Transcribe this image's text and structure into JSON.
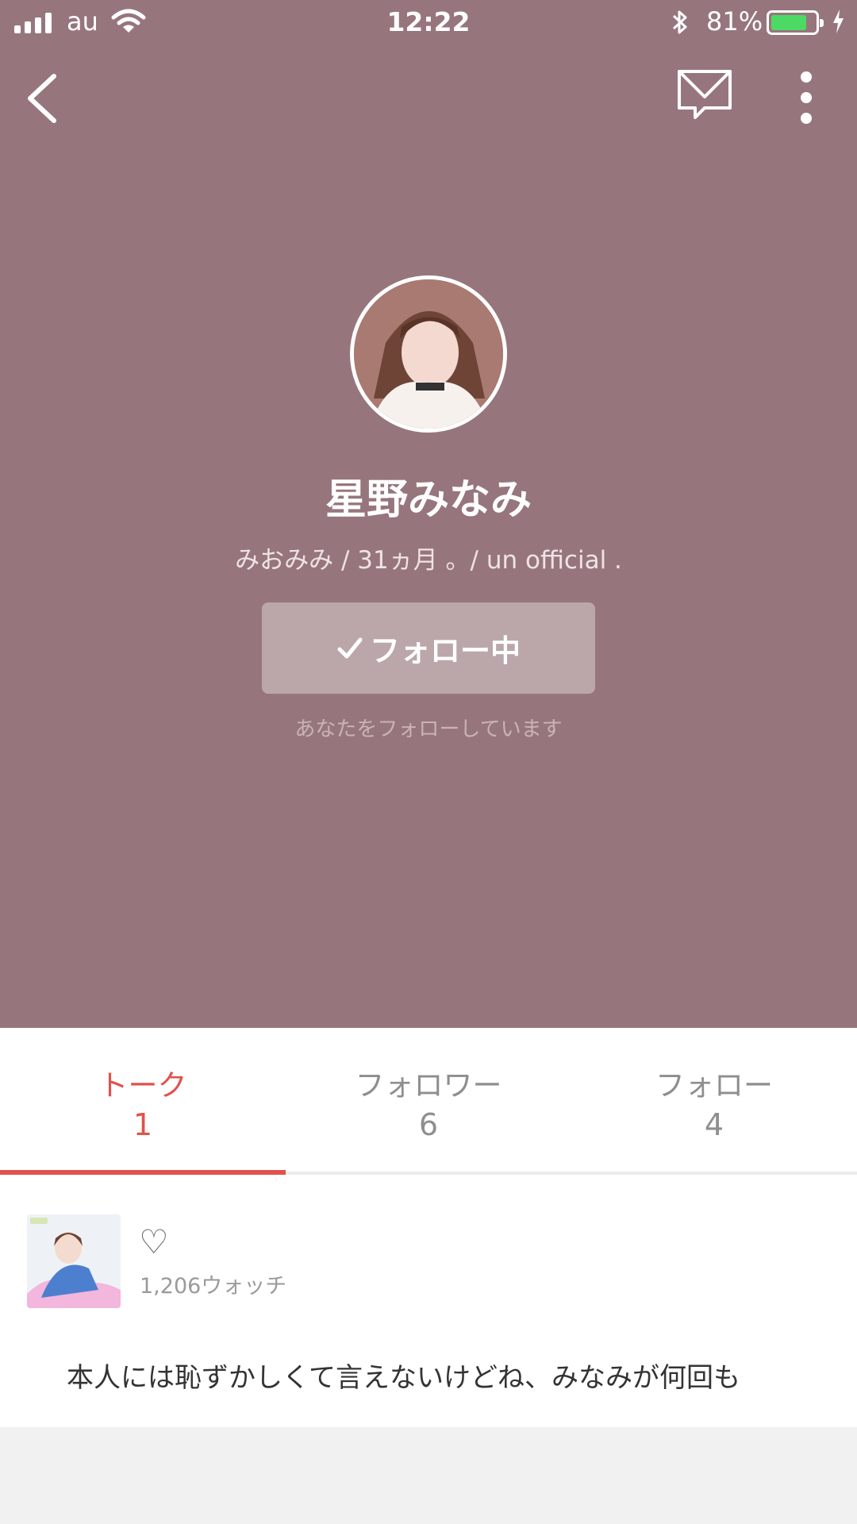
{
  "status_bar": {
    "carrier": "au",
    "time": "12:22",
    "battery_percent_text": "81%",
    "battery_level": 0.81,
    "battery_color": "#4cd964"
  },
  "nav": {
    "back_icon": "chevron-left-icon",
    "message_icon": "envelope-icon",
    "more_icon": "more-vertical-icon"
  },
  "profile": {
    "name": "星野みなみ",
    "tagline": "みおみみ / 31ヵ月 。/ un official .",
    "follow_button_label": "フォロー中",
    "follow_button_icon": "check-icon",
    "follows_you_text": "あなたをフォローしています",
    "header_color": "#96767c"
  },
  "tabs": [
    {
      "label": "トーク",
      "count": "1",
      "active": true
    },
    {
      "label": "フォロワー",
      "count": "6",
      "active": false
    },
    {
      "label": "フォロー",
      "count": "4",
      "active": false
    }
  ],
  "accent_color": "#e0524b",
  "post": {
    "heart_icon": "♡",
    "watch_count": "1,206ウォッチ",
    "text": "本人には恥ずかしくて言えないけどね、みなみが何回も"
  }
}
